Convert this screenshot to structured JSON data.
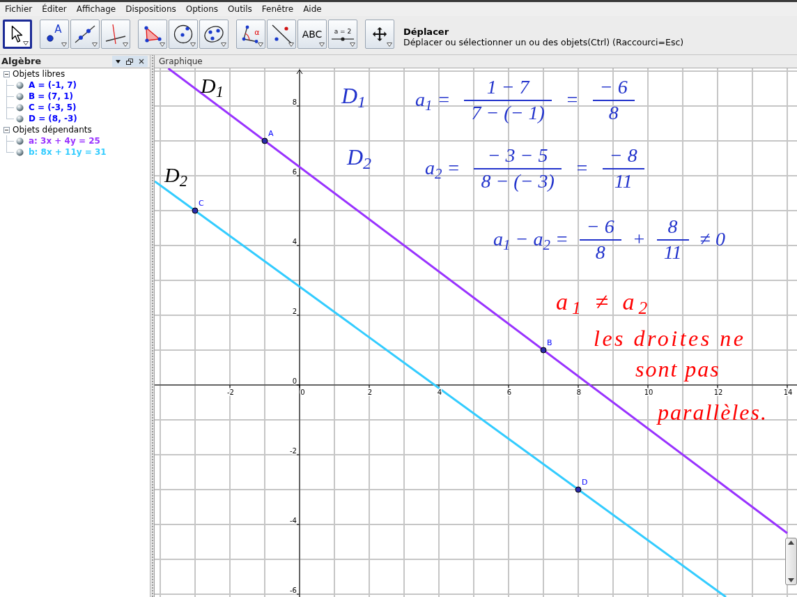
{
  "menu_bar": [
    "Fichier",
    "Éditer",
    "Affichage",
    "Dispositions",
    "Options",
    "Outils",
    "Fenêtre",
    "Aide"
  ],
  "toolbar": {
    "groups": [
      {
        "tools": [
          {
            "kind": "move",
            "selected": true
          }
        ]
      },
      {
        "tools": [
          {
            "kind": "point",
            "glyph": "A",
            "selected": false
          },
          {
            "kind": "line",
            "selected": false
          },
          {
            "kind": "perpendicular",
            "selected": false
          }
        ]
      },
      {
        "tools": [
          {
            "kind": "polygon",
            "selected": false
          },
          {
            "kind": "circle",
            "selected": false
          },
          {
            "kind": "conic",
            "selected": false
          }
        ]
      },
      {
        "tools": [
          {
            "kind": "angle",
            "glyph": "α",
            "selected": false
          },
          {
            "kind": "reflect",
            "selected": false
          },
          {
            "kind": "text",
            "glyph": "ABC",
            "selected": false
          },
          {
            "kind": "slider",
            "glyph": "a = 2",
            "selected": false
          }
        ]
      },
      {
        "tools": [
          {
            "kind": "pan",
            "selected": false
          }
        ]
      }
    ],
    "help": {
      "title": "Déplacer",
      "description": "Déplacer ou sélectionner un ou des objets(Ctrl) (Raccourci=Esc)"
    }
  },
  "algebra": {
    "title": "Algèbre",
    "tree": [
      {
        "label": "Objets libres",
        "expanded": true,
        "children": [
          {
            "text": "A = (-1, 7)",
            "color": "#0000ff",
            "shown": true
          },
          {
            "text": "B = (7, 1)",
            "color": "#0000ff",
            "shown": true
          },
          {
            "text": "C = (-3, 5)",
            "color": "#0000ff",
            "shown": true
          },
          {
            "text": "D = (8, -3)",
            "color": "#0000ff",
            "shown": true
          }
        ]
      },
      {
        "label": "Objets dépendants",
        "expanded": true,
        "children": [
          {
            "text": "a: 3x + 4y = 25",
            "color": "#9933ff",
            "shown": true
          },
          {
            "text": "b: 8x + 11y = 31",
            "color": "#33ccff",
            "shown": true
          }
        ]
      }
    ]
  },
  "graphics": {
    "title": "Graphique",
    "chart_data": {
      "type": "line",
      "grid": true,
      "xlim": [
        -4.16,
        14.28
      ],
      "ylim": [
        -6.08,
        9.08
      ],
      "xticks": [
        -2,
        0,
        2,
        4,
        6,
        8,
        10,
        12,
        14
      ],
      "yticks": [
        -6,
        -4,
        -2,
        0,
        2,
        4,
        6,
        8
      ],
      "x": [
        -4.16,
        -3.77,
        12.24,
        14
      ],
      "series": [
        {
          "color": "#9933ff",
          "values": [
            null,
            9.08,
            -2.93,
            -4.25
          ]
        },
        {
          "color": "#33ccff",
          "values": [
            5.84,
            5.56,
            -6.08,
            null
          ]
        }
      ],
      "annotations": [
        {
          "text": "A",
          "x": -1,
          "y": 7
        },
        {
          "text": "B",
          "x": 7,
          "y": 1
        },
        {
          "text": "C",
          "x": -3,
          "y": 5
        },
        {
          "text": "D",
          "x": 8,
          "y": -3
        }
      ]
    },
    "ink_notes": [
      {
        "color": "#000000",
        "parts": [
          {
            "kind": "text",
            "text": "D$_{1}$"
          }
        ]
      },
      {
        "color": "#000000",
        "parts": [
          {
            "kind": "text",
            "text": "D$_{2}$"
          }
        ]
      },
      {
        "color": "#2233cc",
        "parts": [
          {
            "kind": "text",
            "text": "D$_{1}$"
          }
        ]
      },
      {
        "color": "#2233cc",
        "parts": [
          {
            "kind": "text",
            "text": "D$_{2}$"
          }
        ]
      },
      {
        "color": "#2233cc",
        "parts": [
          {
            "kind": "text",
            "text": "a$_{1}$ ="
          },
          {
            "kind": "fraction",
            "numerator": "1 − 7",
            "denominator": "7 − (− 1)"
          },
          {
            "kind": "text",
            "text": "="
          },
          {
            "kind": "fraction",
            "numerator": "− 6",
            "denominator": "8"
          }
        ]
      },
      {
        "color": "#2233cc",
        "parts": [
          {
            "kind": "text",
            "text": "a$_{2}$ ="
          },
          {
            "kind": "fraction",
            "numerator": "− 3 − 5",
            "denominator": "8 − (− 3)"
          },
          {
            "kind": "text",
            "text": "="
          },
          {
            "kind": "fraction",
            "numerator": "− 8",
            "denominator": "11"
          }
        ]
      },
      {
        "color": "#2233cc",
        "parts": [
          {
            "kind": "text",
            "text": "a$_{1}$ − a$_{2}$ ="
          },
          {
            "kind": "fraction",
            "numerator": "− 6",
            "denominator": "8"
          },
          {
            "kind": "text",
            "text": "+"
          },
          {
            "kind": "fraction",
            "numerator": "8",
            "denominator": "11"
          },
          {
            "kind": "text",
            "text": "≠ 0"
          }
        ]
      },
      {
        "color": "#ff0000",
        "parts": [
          {
            "kind": "text",
            "text": "a$_{1}$ ≠ a$_{2}$"
          }
        ]
      },
      {
        "color": "#ff0000",
        "parts": [
          {
            "kind": "text",
            "text": "les droites ne"
          }
        ]
      },
      {
        "color": "#ff0000",
        "parts": [
          {
            "kind": "text",
            "text": "sont pas"
          }
        ]
      },
      {
        "color": "#ff0000",
        "parts": [
          {
            "kind": "text",
            "text": "parallèles."
          }
        ]
      }
    ]
  }
}
